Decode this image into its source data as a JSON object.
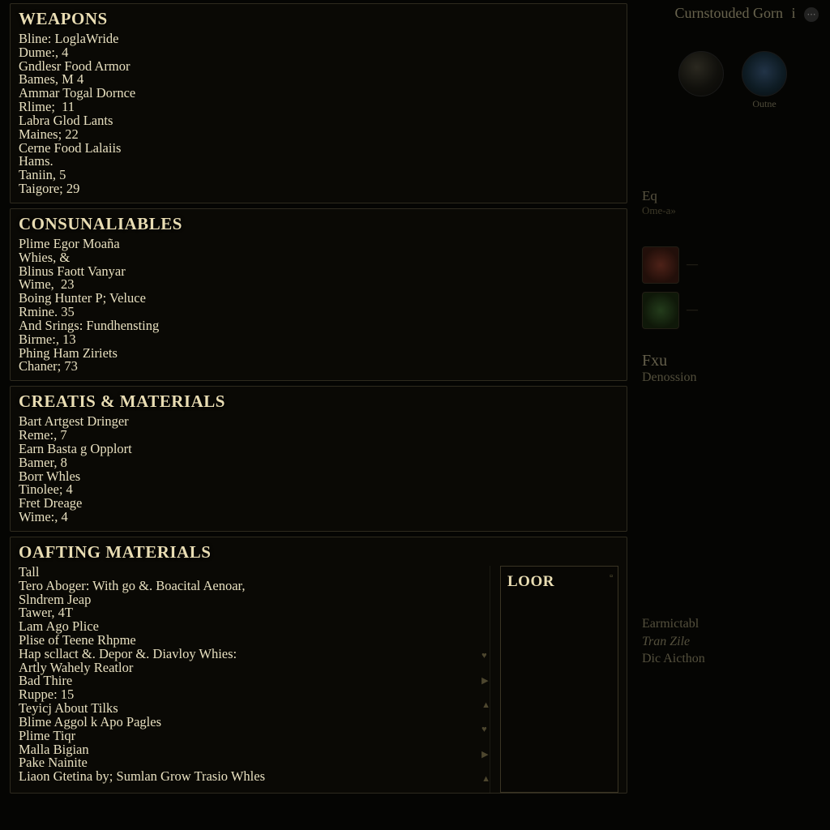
{
  "sections": {
    "weapons": {
      "title": "Weapons",
      "lines": [
        "Bline: LoglaWride",
        "Dume:, 4",
        "Gndlesr Food Armor",
        "Bames, M 4",
        "Ammar Togal Dornce",
        "Rlime;  11",
        "Labra Glod Lants",
        "Maines; 22",
        "Cerne Food Lalaiis",
        "Hams.",
        "Taniin, 5",
        "Taigore; 29"
      ]
    },
    "consumables": {
      "title": "Consunaliables",
      "lines": [
        "Plime Egor Moaña",
        "Whies, &",
        "Blinus Faott Vanyar",
        "Wime,  23",
        "Boing Hunter P; Veluce",
        "Rmine. 35",
        "And Srings: Fundhensting",
        "Birme:, 13",
        "Phing Ham Ziriets",
        "Chaner; 73"
      ]
    },
    "creatis": {
      "title": "Creatis & materials",
      "lines": [
        "Bart Artgest Dringer",
        "Reme:, 7",
        "Earn Basta g Opplort",
        "Bamer, 8",
        "Borr Whles",
        "Tinolee; 4",
        "Fret Dreage",
        "Wime:, 4"
      ]
    },
    "crafting": {
      "title": "Oafting Materials",
      "lines": [
        "Tall",
        "Tero Aboger: With go &. Boacital Aenoar,",
        "Slndrem Jeap",
        "Tawer, 4T",
        "Lam Ago Plice",
        "Plise of Teene Rhpme",
        "",
        "Hap scllact &. Depor &. Diavloy Whies:",
        "Artly Wahely Reatlor",
        "Bad Thire",
        "Ruppe: 15",
        "",
        "Teyicj About Tilks",
        "Blime Aggol k Apo Pagles",
        "Plime Tiqr",
        "Malla Bigian",
        "Pake Nainite",
        "Liaon Gtetina by; Sumlan Grow Trasio Whles"
      ]
    }
  },
  "lore": {
    "title": "Loor"
  },
  "sidebar": {
    "header": "Curnstouded Gorn",
    "header_suffix": "i",
    "portrait_label": "Outne",
    "eq": {
      "label": "Eq",
      "sub": "Ome-a»"
    },
    "fxu": {
      "label": "Fxu",
      "sub": "Denossion"
    },
    "foot": {
      "a": "Earmictabl",
      "b": "Tran Zile",
      "c": "Dic Aicthon"
    }
  }
}
